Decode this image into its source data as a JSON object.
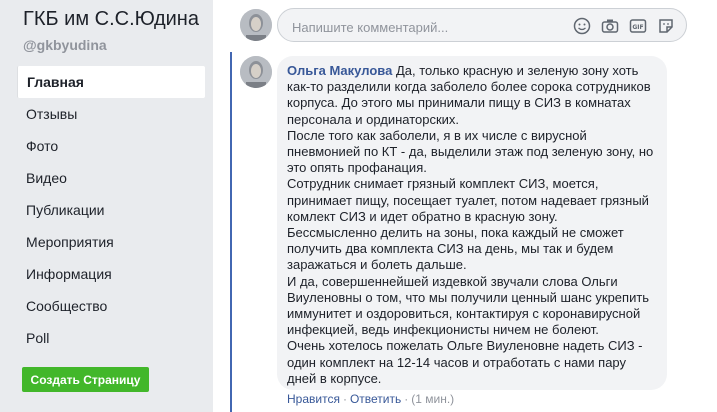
{
  "page": {
    "name": "ГКБ им С.С.Юдина",
    "handle": "@gkbyudina"
  },
  "nav": {
    "items": [
      {
        "label": "Главная"
      },
      {
        "label": "Отзывы"
      },
      {
        "label": "Фото"
      },
      {
        "label": "Видео"
      },
      {
        "label": "Публикации"
      },
      {
        "label": "Мероприятия"
      },
      {
        "label": "Информация"
      },
      {
        "label": "Сообщество"
      },
      {
        "label": "Poll"
      }
    ],
    "active_index": 0
  },
  "create_page_label": "Создать Страницу",
  "composer": {
    "placeholder": "Напишите комментарий...",
    "icons": [
      "emoji-icon",
      "camera-icon",
      "gif-icon",
      "sticker-icon"
    ]
  },
  "comment": {
    "author": "Ольга Макулова",
    "paragraphs": [
      "Да, только красную и зеленую зону хоть как-то разделили когда заболело более сорока сотрудников корпуса. До этого мы принимали пищу в СИЗ в комнатах персонала и ординаторских.",
      "После того как заболели, я в их числе с вирусной пневмонией по КТ - да, выделили этаж под зеленую зону, но это опять профанация.",
      "Сотрудник снимает грязный комплект СИЗ, моется, принимает пищу, посещает туалет, потом надевает грязный комлект СИЗ и идет обратно в красную зону.",
      "Бессмысленно делить на зоны, пока каждый не сможет получить два комплекта СИЗ на день, мы так и будем заражаться и болеть дальше.",
      "И да, совершеннейшей издевкой звучали слова Ольги Виуленовны о том, что мы получили ценный шанс укрепить иммунитет и оздоровиться, контактируя с коронавирусной инфекцией, ведь инфекционисты ничем не болеют.",
      "Очень хотелось пожелать Ольге Виуленовне надеть СИЗ - один комплект на 12-14 часов и отработать с нами пару дней в корпусе."
    ],
    "like_label": "Нравится",
    "reply_label": "Ответить",
    "time": "(1 мин.)",
    "separator": "·"
  },
  "colors": {
    "link": "#385898",
    "accent": "#4267b2",
    "button": "#42b72a",
    "bubble": "#f2f3f5"
  }
}
